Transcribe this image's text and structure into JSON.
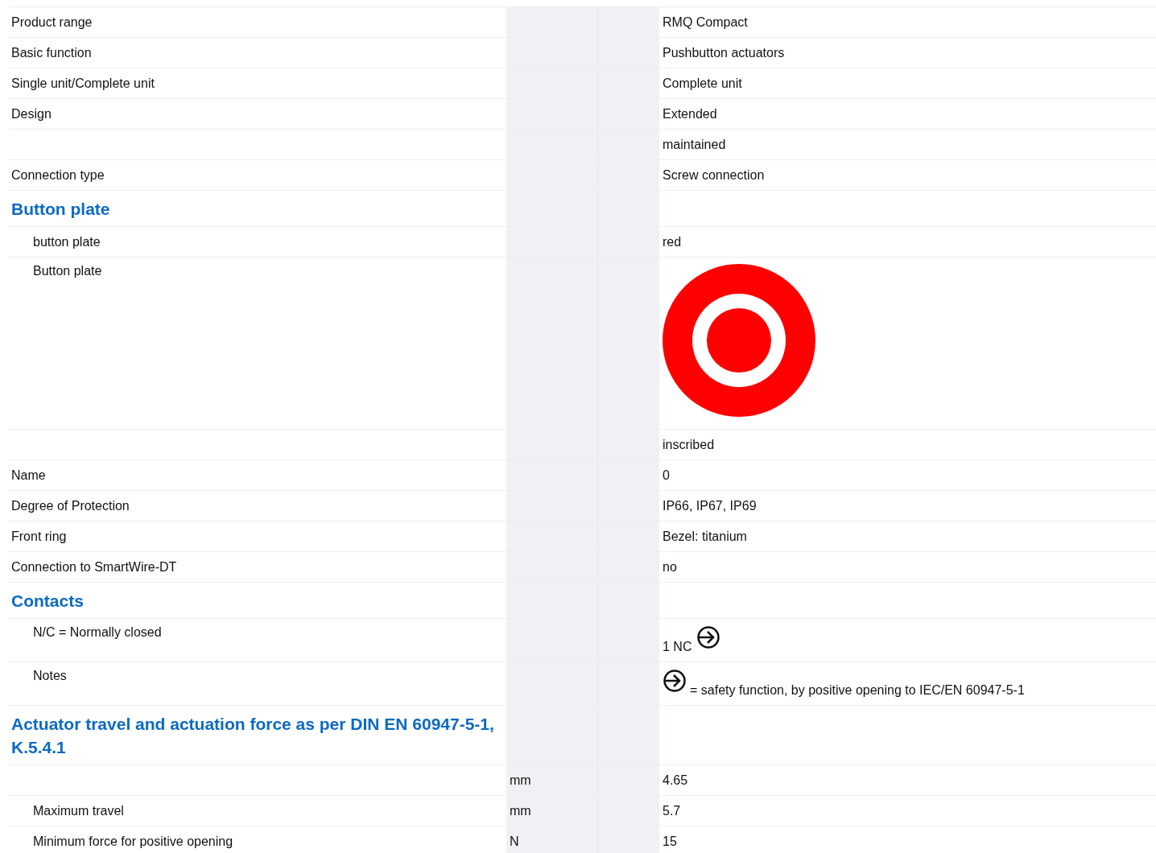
{
  "rows": [
    {
      "kind": "text",
      "label": "Product range",
      "value": "RMQ Compact"
    },
    {
      "kind": "text",
      "label": "Basic function",
      "value": "Pushbutton actuators"
    },
    {
      "kind": "text",
      "label": "Single unit/Complete unit",
      "value": "Complete unit"
    },
    {
      "kind": "text",
      "label": "Design",
      "value": "Extended"
    },
    {
      "kind": "text",
      "value": "maintained"
    },
    {
      "kind": "text",
      "label": "Connection type",
      "value": "Screw connection"
    },
    {
      "kind": "heading",
      "label": "Button plate",
      "children": [
        {
          "kind": "text",
          "label": "button plate",
          "value": "red"
        },
        {
          "kind": "image",
          "label": "Button plate"
        }
      ]
    },
    {
      "kind": "text",
      "value": "inscribed"
    },
    {
      "kind": "text",
      "label": "Name",
      "value": "0"
    },
    {
      "kind": "text",
      "label": "Degree of Protection",
      "value": "IP66, IP67, IP69"
    },
    {
      "kind": "text",
      "label": "Front ring",
      "value": "Bezel: titanium"
    },
    {
      "kind": "text",
      "label": "Connection to SmartWire-DT",
      "value": "no"
    },
    {
      "kind": "heading",
      "label": "Contacts",
      "children": [
        {
          "kind": "symbol_after",
          "label": "N/C = Normally closed",
          "value": "1 NC"
        },
        {
          "kind": "symbol_before",
          "label": "Notes",
          "value": "= safety function, by positive opening to IEC/EN 60947-5-1"
        }
      ]
    },
    {
      "kind": "heading",
      "label": "Actuator travel and actuation force as per DIN EN 60947-5-1, K.5.4.1",
      "children": [
        {
          "kind": "text",
          "unit": "mm",
          "value": "4.65"
        },
        {
          "kind": "text",
          "label": "Maximum travel",
          "unit": "mm",
          "value": "5.7"
        },
        {
          "kind": "text",
          "label": "Minimum force for positive opening",
          "unit": "N",
          "value": "15"
        }
      ]
    }
  ]
}
